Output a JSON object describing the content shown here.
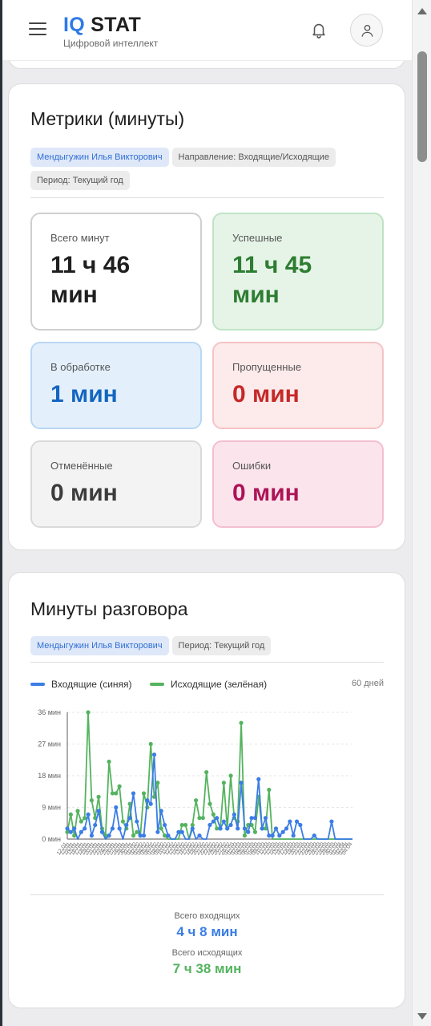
{
  "header": {
    "logo_iq": "IQ",
    "logo_stat": "STAT",
    "subtitle": "Цифровой интеллект"
  },
  "metrics_card": {
    "title": "Метрики (минуты)",
    "chips": [
      "Мендыгужин Илья Викторович",
      "Направление: Входящие/Исходящие",
      "Период: Текущий год"
    ],
    "total": {
      "label": "Всего минут",
      "value": "11 ч 46 мин"
    },
    "success": {
      "label": "Успешные",
      "value": "11 ч 45 мин"
    },
    "processing": {
      "label": "В обработке",
      "value": "1 мин"
    },
    "missed": {
      "label": "Пропущенные",
      "value": "0 мин"
    },
    "cancelled": {
      "label": "Отменённые",
      "value": "0 мин"
    },
    "errors": {
      "label": "Ошибки",
      "value": "0 мин"
    }
  },
  "talk_card": {
    "title": "Минуты разговора",
    "chips": [
      "Мендыгужин Илья Викторович",
      "Период: Текущий год"
    ],
    "legend_in": "Входящие (синяя)",
    "legend_out": "Исходящие (зелёная)",
    "days": "60 дней",
    "total_in_label": "Всего входящих",
    "total_in_value": "4 ч 8 мин",
    "total_out_label": "Всего исходящих",
    "total_out_value": "7 ч 38 мин"
  },
  "colors": {
    "brand": "#2f7ae5",
    "incoming": "#3b7de6",
    "outgoing": "#55b35f"
  },
  "chart_data": {
    "type": "line",
    "ylim": [
      0,
      36
    ],
    "yticks": [
      "0 мин",
      "9 мин",
      "18 мин",
      "27 мин",
      "36 мин"
    ],
    "x": [
      "12.01",
      "13.01",
      "14.01",
      "15.01",
      "16.01",
      "17.01",
      "18.01",
      "19.01",
      "20.01",
      "21.01",
      "22.01",
      "23.01",
      "24.01",
      "25.01",
      "26.01",
      "27.01",
      "28.01",
      "29.01",
      "30.01",
      "31.01",
      "01.02",
      "02.02",
      "03.02",
      "04.02",
      "05.02",
      "06.02",
      "07.02",
      "08.02",
      "09.02",
      "10.02",
      "11.02",
      "12.02",
      "13.02",
      "14.02",
      "15.02",
      "16.02",
      "17.02",
      "18.02",
      "19.02",
      "20.02",
      "21.02",
      "22.02",
      "23.02",
      "24.02",
      "25.02",
      "26.02",
      "27.02",
      "28.02",
      "01.03",
      "02.03",
      "03.03",
      "04.03",
      "05.03",
      "06.03",
      "07.03",
      "08.03",
      "09.03",
      "10.03",
      "11.03",
      "12.03",
      "13.03",
      "14.03",
      "15.03",
      "16.03",
      "17.03",
      "18.03",
      "19.03",
      "20.03",
      "21.03",
      "22.03",
      "23.03",
      "24.03",
      "25.03",
      "26.03",
      "27.03",
      "28.03",
      "29.03",
      "30.03",
      "31.03",
      "01.04",
      "02.04",
      "03.04",
      "04.04"
    ],
    "series": [
      {
        "name": "Входящие (синяя)",
        "values": [
          3,
          2,
          3,
          0,
          2,
          3,
          7,
          1,
          4,
          8,
          2,
          0,
          1,
          3,
          9,
          3,
          0,
          4,
          6,
          13,
          5,
          1,
          1,
          11,
          10,
          24,
          2,
          8,
          4,
          1,
          0,
          0,
          2,
          2,
          0,
          0,
          3,
          0,
          1,
          0,
          0,
          4,
          5,
          6,
          3,
          5,
          3,
          4,
          7,
          3,
          16,
          3,
          2,
          6,
          6,
          17,
          3,
          6,
          1,
          1,
          3,
          1,
          2,
          3,
          5,
          1,
          5,
          4,
          0,
          0,
          0,
          1,
          0,
          0,
          0,
          0,
          5,
          0,
          0,
          0,
          0,
          0,
          0
        ]
      },
      {
        "name": "Исходящие (зелёная)",
        "values": [
          2,
          7,
          1,
          8,
          5,
          6,
          36,
          11,
          6,
          12,
          3,
          1,
          22,
          13,
          13,
          15,
          5,
          3,
          10,
          1,
          2,
          1,
          13,
          9,
          27,
          12,
          16,
          3,
          1,
          0,
          0,
          0,
          0,
          4,
          4,
          0,
          4,
          11,
          6,
          6,
          19,
          10,
          7,
          3,
          3,
          16,
          3,
          18,
          6,
          5,
          33,
          1,
          4,
          4,
          2,
          12,
          3,
          3,
          14,
          0,
          0,
          0,
          0,
          0,
          0,
          0,
          0,
          0,
          0,
          0,
          0,
          0,
          0,
          0,
          0,
          0,
          0,
          0,
          0,
          0,
          0,
          0,
          0
        ]
      }
    ]
  }
}
